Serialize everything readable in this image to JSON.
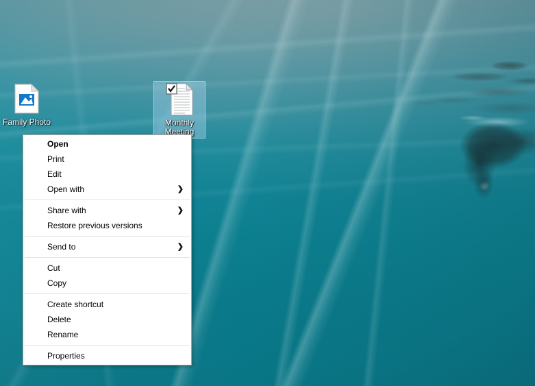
{
  "desktop": {
    "wallpaper_description": "underwater ocean scene with sunrays and a swimmer silhouette",
    "colors": {
      "water_top": "#5e94a0",
      "water_bottom": "#097686",
      "accent_teal": "#0c7f90",
      "selection_fill": "#aad2eb",
      "menu_background": "#ffffff",
      "menu_border": "#a0a0a0",
      "menu_separator": "#e2e2e2",
      "menu_text": "#000000"
    },
    "icons": [
      {
        "id": "family-photo",
        "label": "Family Photo",
        "icon": "image-file-icon",
        "selected": false,
        "checked": false
      },
      {
        "id": "monthly-meeting",
        "label": "Monthly Meeting",
        "icon": "text-document-icon",
        "selected": true,
        "checked": true
      }
    ]
  },
  "context_menu": {
    "target": "Monthly Meeting",
    "groups": [
      {
        "items": [
          {
            "label": "Open",
            "bold": true,
            "submenu": false
          },
          {
            "label": "Print",
            "bold": false,
            "submenu": false
          },
          {
            "label": "Edit",
            "bold": false,
            "submenu": false
          },
          {
            "label": "Open with",
            "bold": false,
            "submenu": true,
            "arrow": "❯"
          }
        ]
      },
      {
        "items": [
          {
            "label": "Share with",
            "bold": false,
            "submenu": true,
            "arrow": "❯"
          },
          {
            "label": "Restore previous versions",
            "bold": false,
            "submenu": false
          }
        ]
      },
      {
        "items": [
          {
            "label": "Send to",
            "bold": false,
            "submenu": true,
            "arrow": "❯"
          }
        ]
      },
      {
        "items": [
          {
            "label": "Cut",
            "bold": false,
            "submenu": false
          },
          {
            "label": "Copy",
            "bold": false,
            "submenu": false
          }
        ]
      },
      {
        "items": [
          {
            "label": "Create shortcut",
            "bold": false,
            "submenu": false
          },
          {
            "label": "Delete",
            "bold": false,
            "submenu": false
          },
          {
            "label": "Rename",
            "bold": false,
            "submenu": false
          }
        ]
      },
      {
        "items": [
          {
            "label": "Properties",
            "bold": false,
            "submenu": false
          }
        ]
      }
    ]
  }
}
